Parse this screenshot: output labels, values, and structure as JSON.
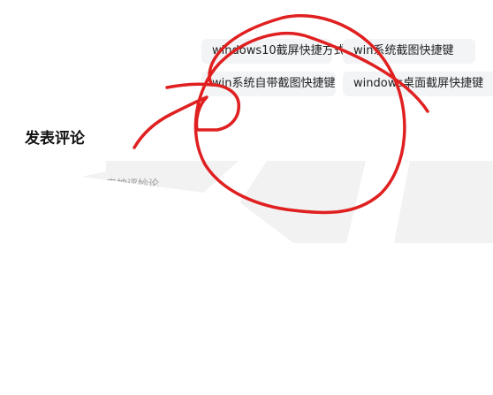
{
  "tags": [
    {
      "label": "windows10截屏快捷方式"
    },
    {
      "label": "win系统截图快捷键"
    },
    {
      "label": "win系统自带截图快捷键"
    },
    {
      "label": "windows桌面截屏快捷键"
    }
  ],
  "comments": {
    "title": "发表评论",
    "placeholder": "来神评妙论"
  },
  "annotation": {
    "color": "#e02020"
  }
}
